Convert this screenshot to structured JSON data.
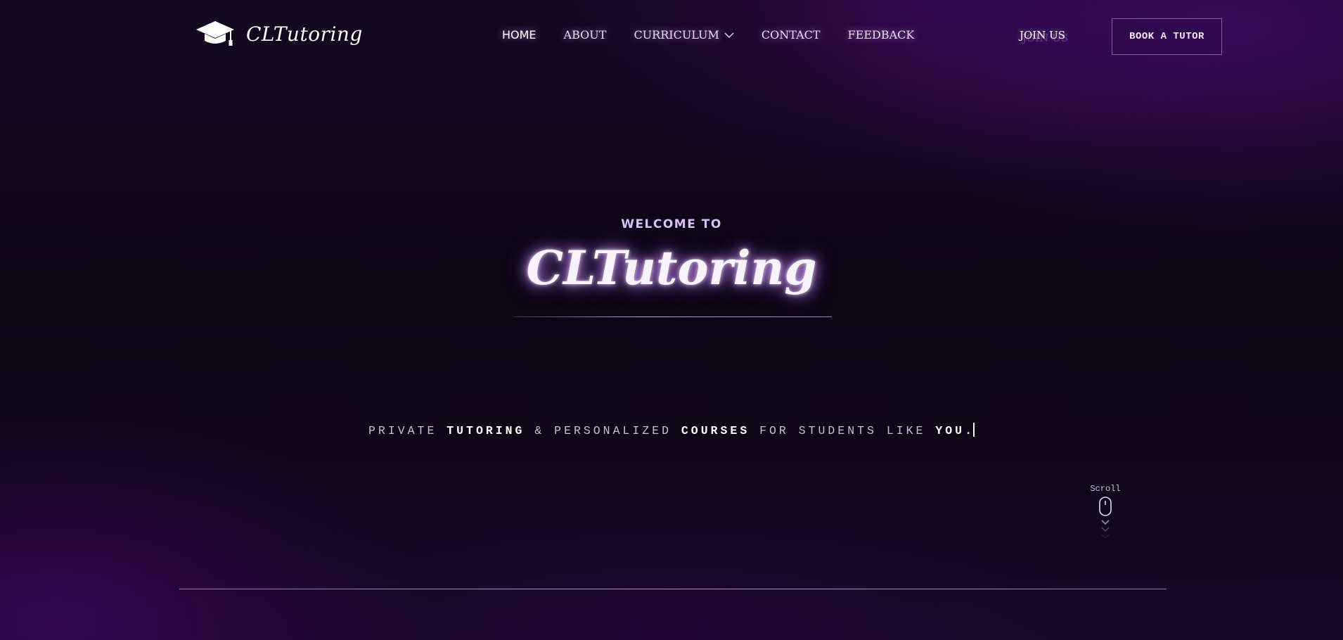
{
  "header": {
    "brand": "CLTutoring",
    "nav": [
      {
        "label": "HOME",
        "active": true
      },
      {
        "label": "ABOUT"
      },
      {
        "label": "CURRICULUM",
        "dropdown": true
      },
      {
        "label": "CONTACT"
      },
      {
        "label": "FEEDBACK"
      }
    ],
    "join_label": "JOIN US",
    "book_label": "BOOK A TUTOR"
  },
  "hero": {
    "welcome": "WELCOME TO",
    "title": "CLTutoring",
    "tagline": {
      "p1": "PRIVATE ",
      "b1": "TUTORING",
      "p2": " & PERSONALIZED ",
      "b2": "COURSES",
      "p3": " FOR STUDENTS LIKE ",
      "b3": "YOU."
    }
  },
  "scroll": {
    "label": "Scroll"
  },
  "icons": [
    "graduation-cap-icon",
    "chevron-down-icon",
    "mouse-icon"
  ],
  "colors": {
    "background": "#0d0514",
    "accent_glow": "#d2a0ff",
    "text": "#ffffff"
  }
}
